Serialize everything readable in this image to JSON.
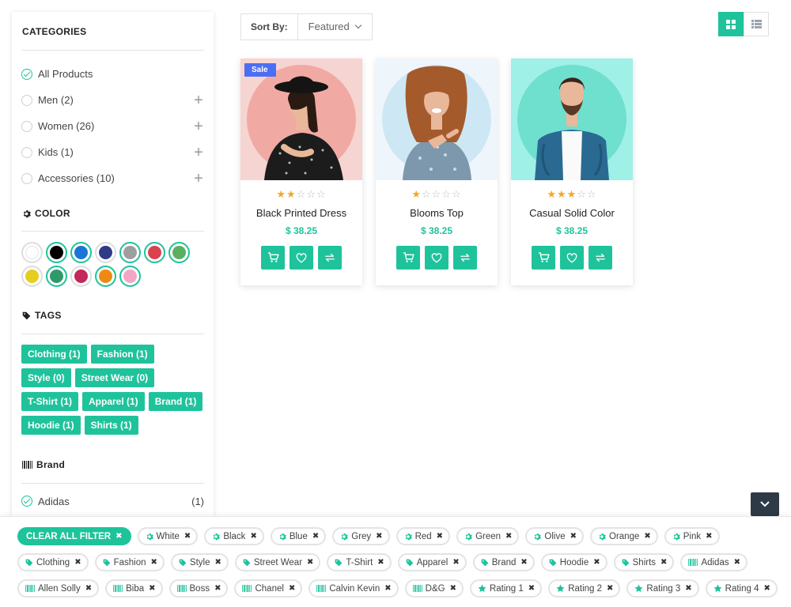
{
  "sidebar": {
    "categories": {
      "title": "CATEGORIES",
      "items": [
        {
          "label": "All Products",
          "checked": true,
          "expandable": false
        },
        {
          "label": "Men (2)",
          "checked": false,
          "expandable": true
        },
        {
          "label": "Women (26)",
          "checked": false,
          "expandable": true
        },
        {
          "label": "Kids (1)",
          "checked": false,
          "expandable": true
        },
        {
          "label": "Accessories (10)",
          "checked": false,
          "expandable": true
        }
      ]
    },
    "color": {
      "title": "COLOR",
      "swatches": [
        "#ffffff",
        "#000000",
        "#1e73d8",
        "#2e3b86",
        "#9e9e9e",
        "#d9424e",
        "#5bb05f",
        "#e6cd1e",
        "#2e9a6a",
        "#c2285a",
        "#ee8a12",
        "#f3a6c6"
      ]
    },
    "tags": {
      "title": "TAGS",
      "items": [
        "Clothing (1)",
        "Fashion (1)",
        "Style (0)",
        "Street Wear (0)",
        "T-Shirt (1)",
        "Apparel (1)",
        "Brand (1)",
        "Hoodie (1)",
        "Shirts (1)"
      ]
    },
    "brand": {
      "title": "Brand",
      "items": [
        {
          "label": "Adidas",
          "count": "(1)",
          "checked": true
        }
      ]
    }
  },
  "toolbar": {
    "sort_label": "Sort By:",
    "sort_value": "Featured",
    "view_grid_icon": "grid-icon",
    "view_list_icon": "list-icon"
  },
  "products": [
    {
      "name": "Black Printed Dress",
      "price": "$ 38.25",
      "rating": 2,
      "max_rating": 5,
      "badge": "Sale",
      "bg": "#f6d4d2",
      "circle": "#f0aaa3"
    },
    {
      "name": "Blooms Top",
      "price": "$ 38.25",
      "rating": 1,
      "max_rating": 5,
      "badge": "",
      "bg": "#eef6fb",
      "circle": "#cde8f4"
    },
    {
      "name": "Casual Solid Color",
      "price": "$ 38.25",
      "rating": 3,
      "max_rating": 5,
      "badge": "",
      "bg": "#9ff0e6",
      "circle": "#6fdfce"
    }
  ],
  "filters": {
    "clear_label": "CLEAR ALL FILTER",
    "chips": [
      {
        "icon": "gear-icon",
        "label": "White"
      },
      {
        "icon": "gear-icon",
        "label": "Black"
      },
      {
        "icon": "gear-icon",
        "label": "Blue"
      },
      {
        "icon": "gear-icon",
        "label": "Grey"
      },
      {
        "icon": "gear-icon",
        "label": "Red"
      },
      {
        "icon": "gear-icon",
        "label": "Green"
      },
      {
        "icon": "gear-icon",
        "label": "Olive"
      },
      {
        "icon": "gear-icon",
        "label": "Orange"
      },
      {
        "icon": "gear-icon",
        "label": "Pink"
      },
      {
        "icon": "tag-icon",
        "label": "Clothing"
      },
      {
        "icon": "tag-icon",
        "label": "Fashion"
      },
      {
        "icon": "tag-icon",
        "label": "Style"
      },
      {
        "icon": "tag-icon",
        "label": "Street Wear"
      },
      {
        "icon": "tag-icon",
        "label": "T-Shirt"
      },
      {
        "icon": "tag-icon",
        "label": "Apparel"
      },
      {
        "icon": "tag-icon",
        "label": "Brand"
      },
      {
        "icon": "tag-icon",
        "label": "Hoodie"
      },
      {
        "icon": "tag-icon",
        "label": "Shirts"
      },
      {
        "icon": "barcode-icon",
        "label": "Adidas"
      },
      {
        "icon": "barcode-icon",
        "label": "Allen Solly"
      },
      {
        "icon": "barcode-icon",
        "label": "Biba"
      },
      {
        "icon": "barcode-icon",
        "label": "Boss"
      },
      {
        "icon": "barcode-icon",
        "label": "Chanel"
      },
      {
        "icon": "barcode-icon",
        "label": "Calvin Kevin"
      },
      {
        "icon": "barcode-icon",
        "label": "D&G"
      },
      {
        "icon": "star-icon",
        "label": "Rating 1"
      },
      {
        "icon": "star-icon",
        "label": "Rating 2"
      },
      {
        "icon": "star-icon",
        "label": "Rating 3"
      },
      {
        "icon": "star-icon",
        "label": "Rating 4"
      }
    ]
  },
  "colors": {
    "accent": "#1fc39b",
    "sale_badge": "#4c6ef5",
    "star": "#f5a623",
    "dark_button": "#2e3a45"
  }
}
